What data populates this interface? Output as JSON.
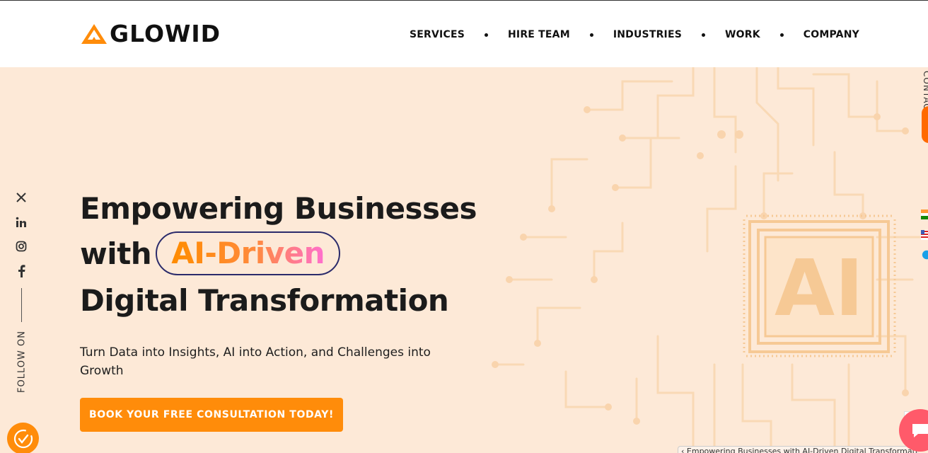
{
  "brand": {
    "logo_text": "GLOWID",
    "accent": "#ff8c0a",
    "hero_bg": "#fde9d7"
  },
  "nav": {
    "items": [
      {
        "label": "SERVICES"
      },
      {
        "label": "HIRE TEAM"
      },
      {
        "label": "INDUSTRIES"
      },
      {
        "label": "WORK"
      },
      {
        "label": "COMPANY"
      }
    ]
  },
  "social": {
    "icons": [
      "x-icon",
      "linkedin-icon",
      "instagram-icon",
      "facebook-icon"
    ],
    "follow_label": "FOLLOW ON"
  },
  "hero": {
    "line1": "Empowering Businesses",
    "line2_prefix": "with",
    "highlight": "AI-Driven",
    "line3": "Digital Transformation",
    "subtext": "Turn Data into Insights, AI into Action, and Challenges into Growth",
    "cta_label": "BOOK YOUR FREE CONSULTATION TODAY!",
    "chip_text": "AI"
  },
  "right_edge": {
    "contact_label": "CONTACT"
  },
  "breadcrumb": {
    "text": "Empowering Businesses with AI-Driven Digital Transformation"
  }
}
